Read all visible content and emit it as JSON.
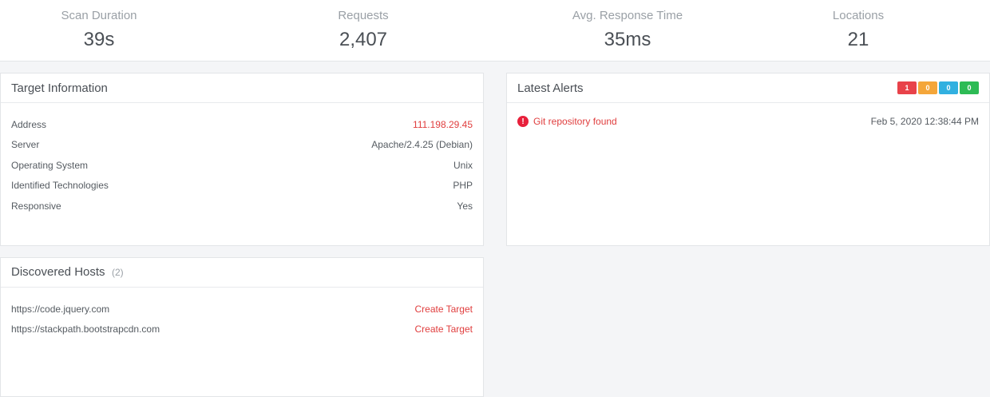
{
  "stats": [
    {
      "label": "Scan Duration",
      "value": "39s"
    },
    {
      "label": "Requests",
      "value": "2,407"
    },
    {
      "label": "Avg. Response Time",
      "value": "35ms"
    },
    {
      "label": "Locations",
      "value": "21"
    }
  ],
  "target_info": {
    "title": "Target Information",
    "rows": [
      {
        "label": "Address",
        "value": "111.198.29.45"
      },
      {
        "label": "Server",
        "value": "Apache/2.4.25 (Debian)"
      },
      {
        "label": "Operating System",
        "value": "Unix"
      },
      {
        "label": "Identified Technologies",
        "value": "PHP"
      },
      {
        "label": "Responsive",
        "value": "Yes"
      }
    ]
  },
  "latest_alerts": {
    "title": "Latest Alerts",
    "badges": [
      {
        "count": "1",
        "color": "#e8424a"
      },
      {
        "count": "0",
        "color": "#f4a63a"
      },
      {
        "count": "0",
        "color": "#31b0e0"
      },
      {
        "count": "0",
        "color": "#2dbb55"
      }
    ],
    "alerts": [
      {
        "icon": "exclamation-circle-icon",
        "name": "Git repository found",
        "time": "Feb 5, 2020 12:38:44 PM"
      }
    ]
  },
  "discovered_hosts": {
    "title": "Discovered Hosts",
    "count": "(2)",
    "hosts": [
      {
        "url": "https://code.jquery.com",
        "action": "Create Target"
      },
      {
        "url": "https://stackpath.bootstrapcdn.com",
        "action": "Create Target"
      }
    ]
  },
  "colors": {
    "accent_red": "#e03e3e",
    "alert_icon": "#e8203b"
  }
}
